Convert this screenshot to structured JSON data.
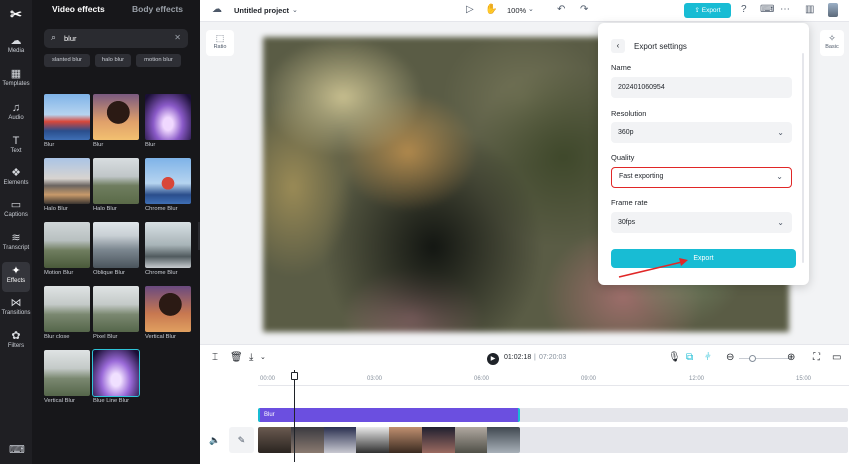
{
  "sidebar": {
    "items": [
      {
        "label": "Media",
        "icon": "☁"
      },
      {
        "label": "Templates",
        "icon": "▦"
      },
      {
        "label": "Audio",
        "icon": "♫"
      },
      {
        "label": "Text",
        "icon": "T"
      },
      {
        "label": "Elements",
        "icon": "❖"
      },
      {
        "label": "Captions",
        "icon": "▭"
      },
      {
        "label": "Transcript",
        "icon": "≋"
      },
      {
        "label": "Effects",
        "icon": "✦"
      },
      {
        "label": "Transitions",
        "icon": "⋈"
      },
      {
        "label": "Filters",
        "icon": "✿"
      }
    ]
  },
  "effects_panel": {
    "tabs": [
      "Video effects",
      "Body effects"
    ],
    "search": {
      "value": "blur"
    },
    "chips": [
      "slanted blur",
      "halo blur",
      "motion blur"
    ],
    "items": [
      {
        "label": "Blur"
      },
      {
        "label": "Blur"
      },
      {
        "label": "Blur"
      },
      {
        "label": "Halo Blur"
      },
      {
        "label": "Halo Blur"
      },
      {
        "label": "Chrome Blur"
      },
      {
        "label": "Motion Blur"
      },
      {
        "label": "Oblique Blur"
      },
      {
        "label": "Chrome Blur"
      },
      {
        "label": "Blur close"
      },
      {
        "label": "Pixel Blur"
      },
      {
        "label": "Vertical Blur"
      },
      {
        "label": "Vertical Blur"
      },
      {
        "label": "Blue Line Blur"
      }
    ]
  },
  "topbar": {
    "project_title": "Untitled project",
    "zoom": "100%",
    "export_label": "Export"
  },
  "stage": {
    "ratio_label": "Ratio",
    "basic_label": "Basic"
  },
  "export_settings": {
    "title": "Export settings",
    "name_label": "Name",
    "name_value": "202401060954",
    "resolution_label": "Resolution",
    "resolution_value": "360p",
    "quality_label": "Quality",
    "quality_value": "Fast exporting",
    "framerate_label": "Frame rate",
    "framerate_value": "30fps",
    "export_button": "Export"
  },
  "timeline": {
    "current_time": "01:02:18",
    "separator": "|",
    "total_time": "07:20:03",
    "ruler": [
      "00:00",
      "03:00",
      "06:00",
      "09:00",
      "12:00",
      "15:00"
    ],
    "effect_clip_label": "Blur"
  },
  "colors": {
    "accent": "#18bcd4",
    "effect_clip": "#6b4fe0",
    "highlight": "#e02727"
  }
}
